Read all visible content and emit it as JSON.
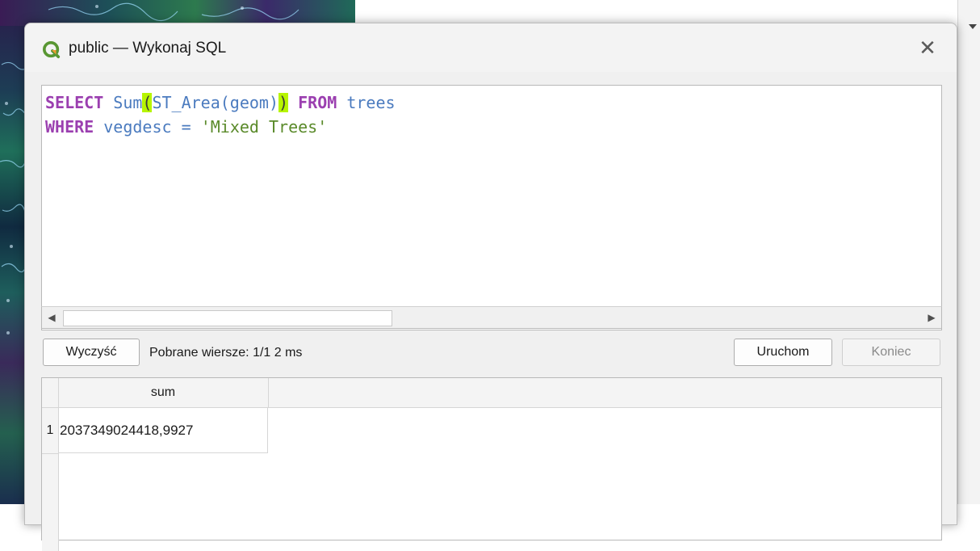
{
  "window": {
    "title": "public — Wykonaj SQL",
    "close_symbol": "✕"
  },
  "editor": {
    "line1": {
      "kw_select": "SELECT",
      "fn_sum": "Sum",
      "paren_open": "(",
      "fn_area": "ST_Area(geom)",
      "paren_close": ")",
      "kw_from": "FROM",
      "table": "trees"
    },
    "line2": {
      "kw_where": "WHERE",
      "column": "vegdesc",
      "op": "=",
      "literal": "'Mixed Trees'"
    },
    "scroll_left": "◀",
    "scroll_right": "▶"
  },
  "toolbar": {
    "clear_label": "Wyczyść",
    "status_text": "Pobrane wiersze: 1/1  2 ms",
    "run_label": "Uruchom",
    "stop_label": "Koniec"
  },
  "results": {
    "columns": [
      "sum"
    ],
    "rows": [
      {
        "index": "1",
        "values": [
          "2037349024418,9927"
        ]
      }
    ]
  },
  "icons": {
    "app_logo": "qgis-logo-icon",
    "close": "close-icon"
  },
  "colors": {
    "keyword": "#9b3fb0",
    "identifier": "#4b7bbf",
    "string": "#5a8a2a",
    "bracket_highlight": "#b7f500"
  }
}
